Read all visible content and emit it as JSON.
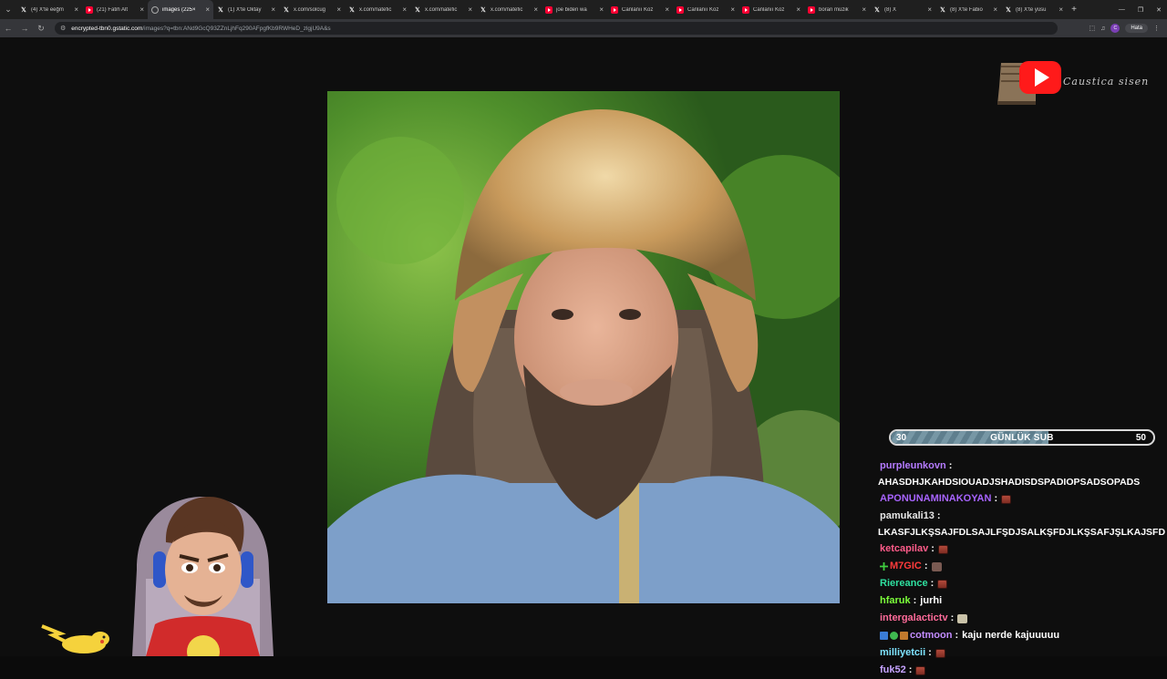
{
  "tabs": [
    {
      "favicon": "x",
      "title": "(4) X'te eeğm",
      "active": false
    },
    {
      "favicon": "yt",
      "title": "(21) Fatih Alt",
      "active": false
    },
    {
      "favicon": "g",
      "title": "images (225×",
      "active": true
    },
    {
      "favicon": "x",
      "title": "(1) X'te Oktay",
      "active": false
    },
    {
      "favicon": "x",
      "title": "x.com/solcug",
      "active": false
    },
    {
      "favicon": "x",
      "title": "x.com/natefic",
      "active": false
    },
    {
      "favicon": "x",
      "title": "x.com/natefic",
      "active": false
    },
    {
      "favicon": "x",
      "title": "x.com/natefic",
      "active": false
    },
    {
      "favicon": "yt",
      "title": "joe biden wa",
      "active": false
    },
    {
      "favicon": "yt",
      "title": "Canlanıı Koz",
      "active": false
    },
    {
      "favicon": "yt",
      "title": "Canlanıı Koz",
      "active": false
    },
    {
      "favicon": "yt",
      "title": "Canlanıı Koz",
      "active": false
    },
    {
      "favicon": "yt",
      "title": "boran müzik",
      "active": false
    },
    {
      "favicon": "x",
      "title": "(8) X",
      "active": false
    },
    {
      "favicon": "x",
      "title": "(8) X'te Fabio",
      "active": false
    },
    {
      "favicon": "x",
      "title": "(8) X'te yüsu",
      "active": false
    }
  ],
  "address": {
    "host": "encrypted-tbn0.gstatic.com",
    "path": "/images?q=tbn:ANd9GcQ93ZZnLjhFq290AFpgfKb9RWHeD_zlgjU9A&s"
  },
  "toolbar": {
    "error_chip": "Hata",
    "profile_initial": "C"
  },
  "logo": {
    "text": "Caustica sisen"
  },
  "subgoal": {
    "current": "30",
    "label": "GÜNLÜK SUB",
    "goal": "50",
    "fill_fraction": 0.6
  },
  "chat": [
    {
      "user": "purpleunkovn",
      "color": "#b57bff",
      "text": "AHASDHJKAHDSIOUADJSHADISDSPADIOPSADSOPADS",
      "wrap": true,
      "badges": [],
      "emote": ""
    },
    {
      "user": "APONUNAMINAKOYAN",
      "color": "#a864ff",
      "text": "",
      "wrap": false,
      "badges": [],
      "emote": "brick"
    },
    {
      "user": "pamukali13",
      "color": "#e6e6e6",
      "text": "LKASFJLKŞSAJFDLSAJLFŞDJSALKŞFDJLKŞSAFJŞLKAJSFD",
      "wrap": true,
      "badges": [],
      "emote": ""
    },
    {
      "user": "ketcapilav",
      "color": "#ff5c8a",
      "text": "",
      "wrap": false,
      "badges": [],
      "emote": "brick"
    },
    {
      "user": "M7GIC",
      "color": "#ff3b3b",
      "text": "",
      "wrap": false,
      "badges": [
        "green"
      ],
      "emote": "bag"
    },
    {
      "user": "Riereance",
      "color": "#2fe0a0",
      "text": "",
      "wrap": false,
      "badges": [],
      "emote": "brick"
    },
    {
      "user": "hfaruk",
      "color": "#7cff3a",
      "text": "jurhi",
      "wrap": false,
      "badges": [],
      "emote": ""
    },
    {
      "user": "intergalactictv",
      "color": "#ff6b9a",
      "text": "",
      "wrap": false,
      "badges": [],
      "emote": "box"
    },
    {
      "user": "cotmoon",
      "color": "#c28cff",
      "text": "kaju nerde kajuuuuu",
      "wrap": false,
      "badges": [
        "blue",
        "round",
        "gift"
      ],
      "emote": ""
    },
    {
      "user": "milliyetcii",
      "color": "#7ee3ff",
      "text": "",
      "wrap": false,
      "badges": [],
      "emote": "brick"
    },
    {
      "user": "fuk52",
      "color": "#c6a3ff",
      "text": "",
      "wrap": false,
      "badges": [],
      "emote": "brick"
    }
  ]
}
